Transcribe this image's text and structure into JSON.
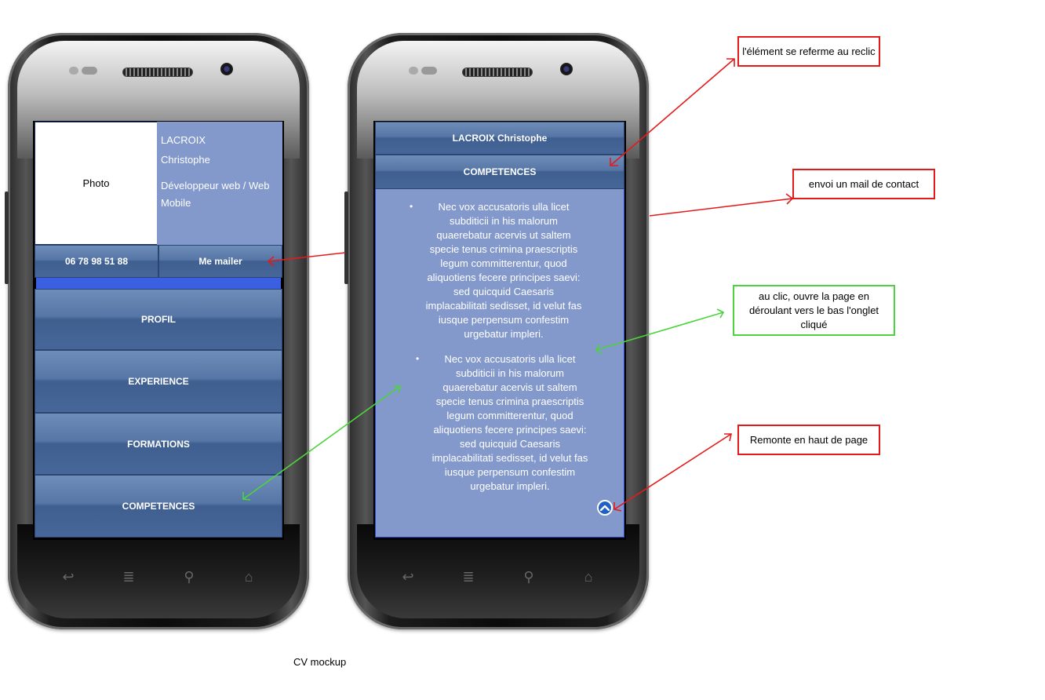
{
  "left_phone": {
    "photo_label": "Photo",
    "last_name": "LACROIX",
    "first_name": "Christophe",
    "job_title": "Développeur web / Web Mobile",
    "phone_button": "06 78 98 51 88",
    "mail_button": "Me mailer",
    "menu": [
      "PROFIL",
      "EXPERIENCE",
      "FORMATIONS",
      "COMPETENCES"
    ]
  },
  "right_phone": {
    "header_title": "LACROIX Christophe",
    "section_title": "COMPETENCES",
    "list_items": [
      "Nec vox accusatoris ulla licet subditicii in his malorum quaerebatur acervis ut saltem specie tenus crimina praescriptis legum committerentur, quod aliquotiens fecere principes saevi: sed quicquid Caesaris implacabilitati sedisset, id velut fas iusque perpensum confestim urgebatur impleri.",
      "Nec vox accusatoris ulla licet subditicii in his malorum quaerebatur acervis ut saltem specie tenus crimina praescriptis legum committerentur, quod aliquotiens fecere principes saevi: sed quicquid Caesaris implacabilitati sedisset, id velut fas iusque perpensum confestim urgebatur impleri."
    ],
    "scroll_top_icon": "chevron-up-icon"
  },
  "annotations": {
    "collapse_note": "l'élément se referme au reclic",
    "mail_note": "envoi un mail de contact",
    "open_note": "au clic, ouvre la page en déroulant vers le bas l'onglet cliqué",
    "top_note": "Remonte en haut de page"
  },
  "caption": "CV mockup",
  "colors": {
    "screen_bg": "#8398cb",
    "button_blue": "#4f6fa0",
    "highlight_bar": "#3a5fe0",
    "arrow_red": "#e31b1b",
    "arrow_green": "#4cd43c"
  }
}
